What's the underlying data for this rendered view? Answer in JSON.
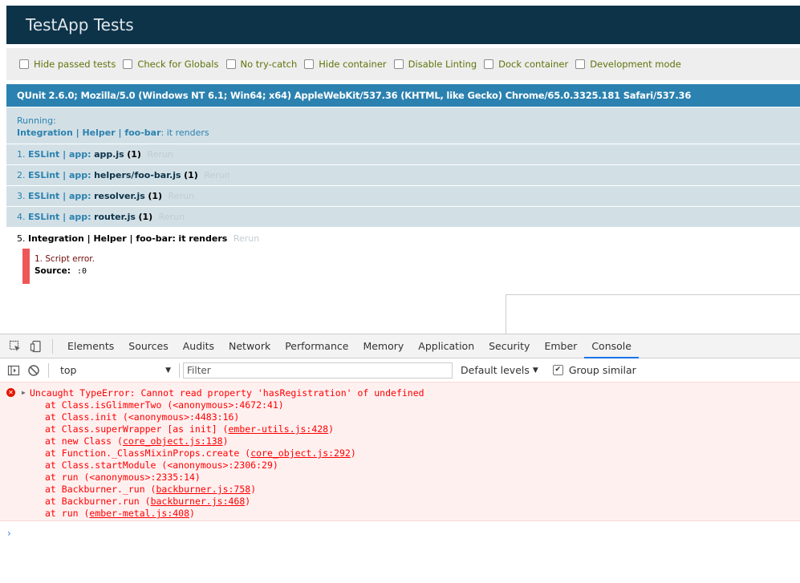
{
  "header": {
    "title": "TestApp Tests"
  },
  "toolbar": {
    "options": [
      "Hide passed tests",
      "Check for Globals",
      "No try-catch",
      "Hide container",
      "Disable Linting",
      "Dock container",
      "Development mode"
    ]
  },
  "user_agent": "QUnit 2.6.0; Mozilla/5.0 (Windows NT 6.1; Win64; x64) AppleWebKit/537.36 (KHTML, like Gecko) Chrome/65.0.3325.181 Safari/537.36",
  "running": {
    "label": "Running:",
    "module": "Integration | Helper | foo-bar",
    "test": ": it renders"
  },
  "tests": [
    {
      "num": "1.",
      "module": "ESLint | app:",
      "name": "app.js",
      "count": "(1)",
      "rerun": "Rerun"
    },
    {
      "num": "2.",
      "module": "ESLint | app:",
      "name": "helpers/foo-bar.js",
      "count": "(1)",
      "rerun": "Rerun"
    },
    {
      "num": "3.",
      "module": "ESLint | app:",
      "name": "resolver.js",
      "count": "(1)",
      "rerun": "Rerun"
    },
    {
      "num": "4.",
      "module": "ESLint | app:",
      "name": "router.js",
      "count": "(1)",
      "rerun": "Rerun"
    },
    {
      "num": "5.",
      "module": "Integration | Helper | foo-bar:",
      "name": "it renders",
      "count": "",
      "rerun": "Rerun"
    }
  ],
  "assertion": {
    "message": "1. Script error.",
    "source_label": "Source:",
    "source_value": ":0"
  },
  "devtools": {
    "tabs": [
      "Elements",
      "Sources",
      "Audits",
      "Network",
      "Performance",
      "Memory",
      "Application",
      "Security",
      "Ember",
      "Console"
    ],
    "active_tab": "Console",
    "context": "top",
    "filter_placeholder": "Filter",
    "levels": "Default levels",
    "group_similar": "Group similar",
    "error": {
      "message": "Uncaught TypeError: Cannot read property 'hasRegistration' of undefined",
      "frames": [
        {
          "text": "at Class.isGlimmerTwo (<anonymous>:4672:41)",
          "loc": ""
        },
        {
          "text": "at Class.init (<anonymous>:4483:16)",
          "loc": ""
        },
        {
          "text": "at Class.superWrapper [as init] (",
          "loc": "ember-utils.js:428",
          "tail": ")"
        },
        {
          "text": "at new Class (",
          "loc": "core_object.js:138",
          "tail": ")"
        },
        {
          "text": "at Function._ClassMixinProps.create (",
          "loc": "core_object.js:292",
          "tail": ")"
        },
        {
          "text": "at Class.startModule (<anonymous>:2306:29)",
          "loc": ""
        },
        {
          "text": "at run (<anonymous>:2335:14)",
          "loc": ""
        },
        {
          "text": "at Backburner._run (",
          "loc": "backburner.js:758",
          "tail": ")"
        },
        {
          "text": "at Backburner.run (",
          "loc": "backburner.js:468",
          "tail": ")"
        },
        {
          "text": "at run (",
          "loc": "ember-metal.js:408",
          "tail": ")"
        }
      ]
    },
    "prompt": "›"
  }
}
